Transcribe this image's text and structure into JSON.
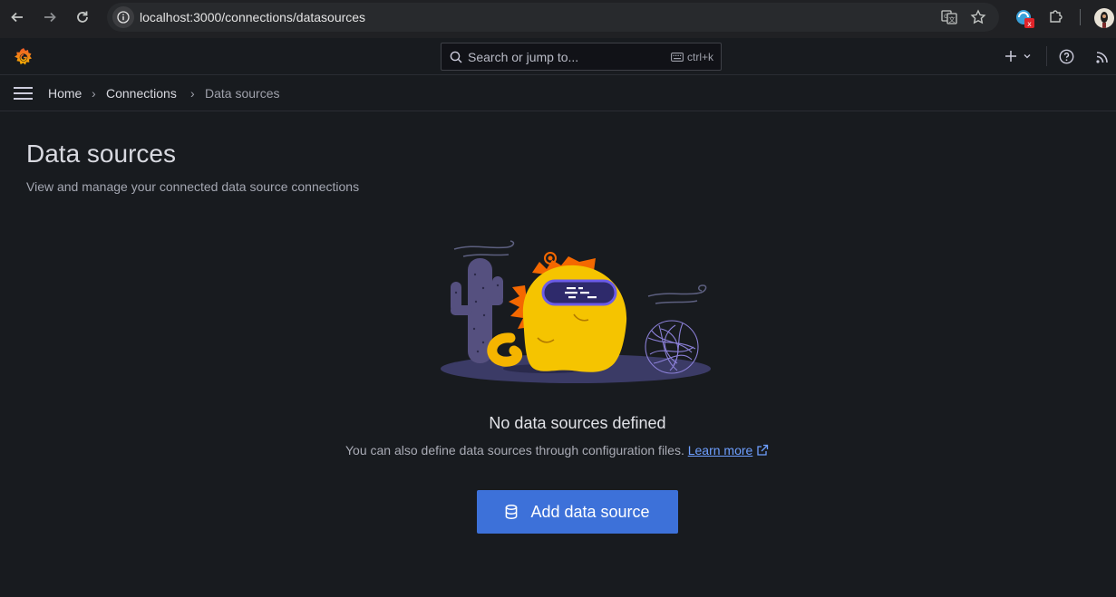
{
  "browser": {
    "url": "localhost:3000/connections/datasources"
  },
  "topbar": {
    "search_placeholder": "Search or jump to...",
    "search_shortcut": "ctrl+k"
  },
  "breadcrumbs": {
    "home": "Home",
    "connections": "Connections",
    "current": "Data sources",
    "separator": "›"
  },
  "page": {
    "title": "Data sources",
    "subtitle": "View and manage your connected data source connections"
  },
  "empty_state": {
    "title": "No data sources defined",
    "description": "You can also define data sources through configuration files.",
    "link_label": "Learn more",
    "button_label": "Add data source"
  },
  "colors": {
    "accent": "#3d71d9",
    "link": "#6e9fff",
    "brand_orange": "#f46800"
  }
}
